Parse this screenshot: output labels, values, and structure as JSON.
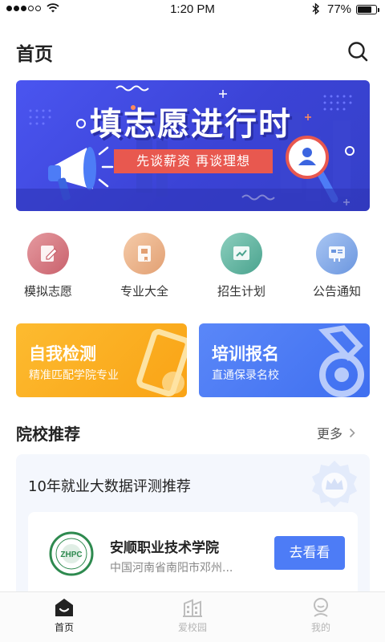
{
  "status_bar": {
    "time": "1:20 PM",
    "battery": "77%",
    "battery_level": 0.77
  },
  "header": {
    "title": "首页",
    "search_icon": "search-icon"
  },
  "banner": {
    "title": "填志愿进行时",
    "subtitle": "先谈薪资  再谈理想"
  },
  "quick_entries": [
    {
      "label": "模拟志愿",
      "icon": "pencil-note-icon",
      "color": "#d9757f"
    },
    {
      "label": "专业大全",
      "icon": "book-icon",
      "color": "#eab38f"
    },
    {
      "label": "招生计划",
      "icon": "chart-icon",
      "color": "#5fb39f"
    },
    {
      "label": "公告通知",
      "icon": "notice-icon",
      "color": "#7aa6e8"
    }
  ],
  "feature_cards": [
    {
      "title": "自我检测",
      "subtitle": "精准匹配学院专业",
      "color": "#fcb228"
    },
    {
      "title": "培训报名",
      "subtitle": "直通保录名校",
      "color": "#4d7cf6"
    }
  ],
  "recommend": {
    "section_title": "院校推荐",
    "more_label": "更多",
    "panel_title": "10年就业大数据评测推荐",
    "school": {
      "name": "安顺职业技术学院",
      "location": "中国河南省南阳市邓州...",
      "logo_text": "ZHPC",
      "button_label": "去看看"
    }
  },
  "tab_bar": {
    "tabs": [
      {
        "label": "首页",
        "icon": "home-icon",
        "active": true
      },
      {
        "label": "爱校园",
        "icon": "campus-icon",
        "active": false
      },
      {
        "label": "我的",
        "icon": "profile-icon",
        "active": false
      }
    ]
  }
}
